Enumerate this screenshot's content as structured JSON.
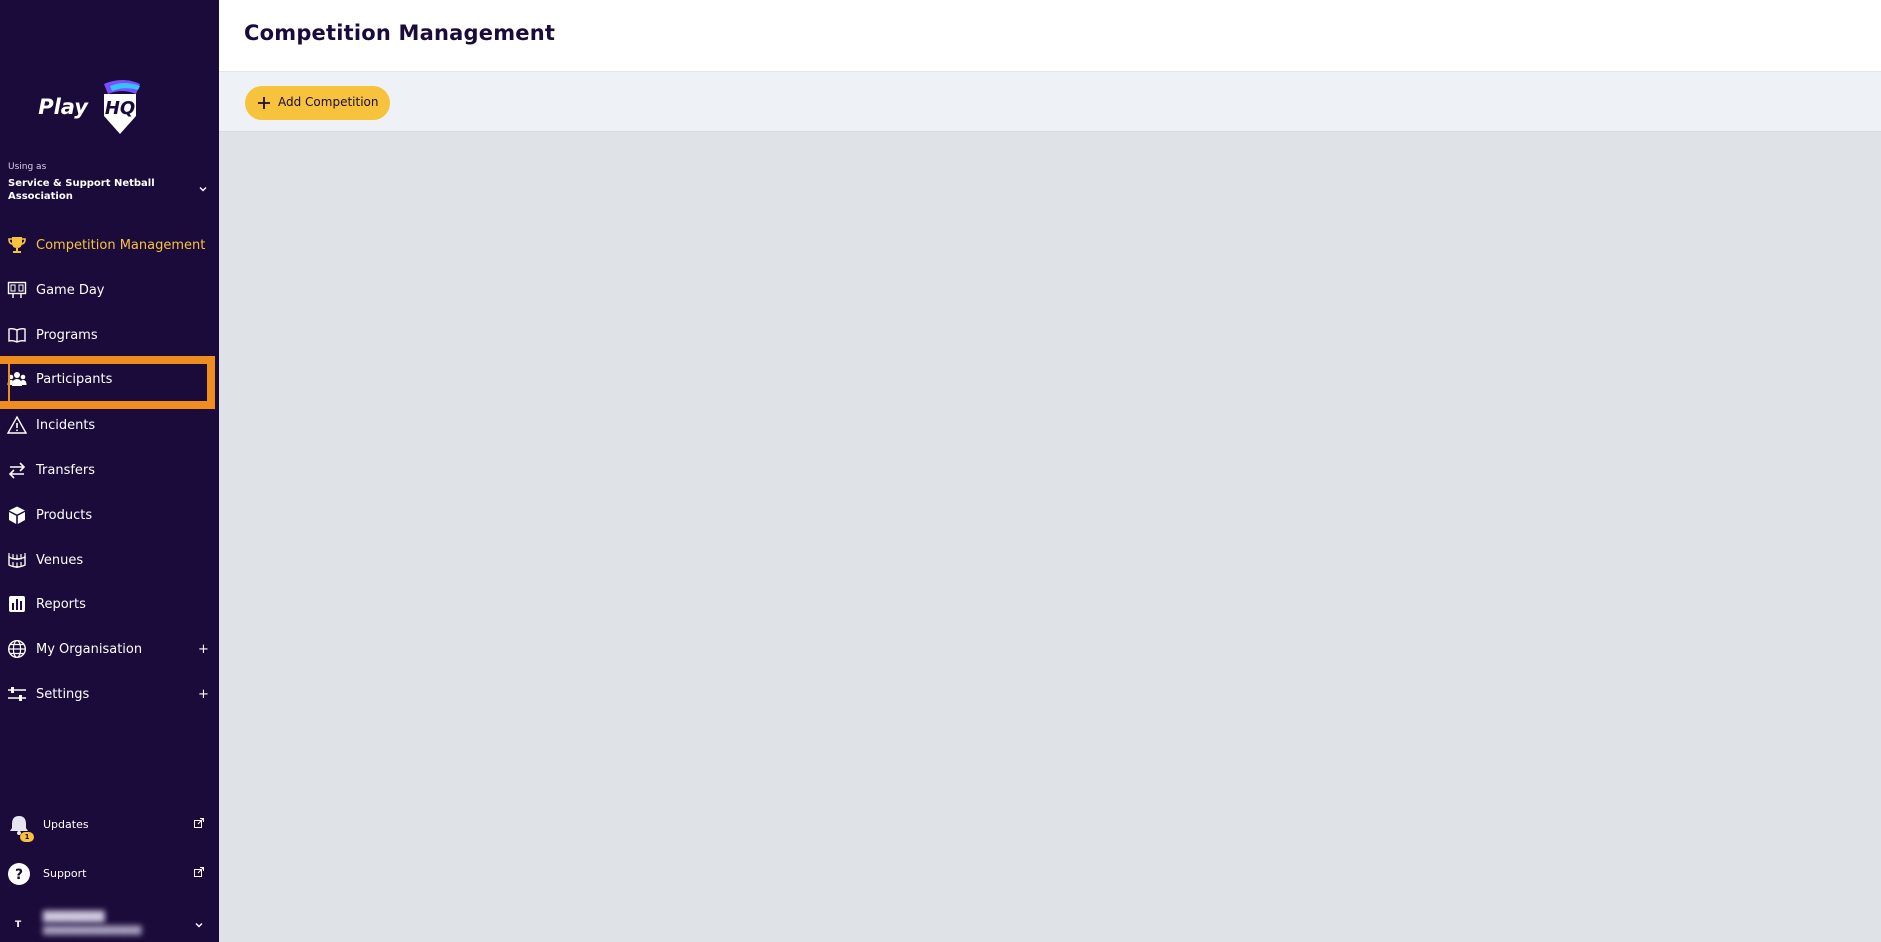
{
  "app": {
    "logo_text": "PlayHQ"
  },
  "sidebar": {
    "using_as_label": "Using as",
    "organisation": "Service & Support Netball Association",
    "items": [
      {
        "label": "Competition Management",
        "icon": "trophy-icon",
        "active": true
      },
      {
        "label": "Game Day",
        "icon": "scoreboard-icon"
      },
      {
        "label": "Programs",
        "icon": "book-icon"
      },
      {
        "label": "Participants",
        "icon": "people-icon"
      },
      {
        "label": "Incidents",
        "icon": "warning-icon"
      },
      {
        "label": "Transfers",
        "icon": "transfer-arrows-icon"
      },
      {
        "label": "Products",
        "icon": "box-icon"
      },
      {
        "label": "Venues",
        "icon": "stadium-icon"
      },
      {
        "label": "Reports",
        "icon": "report-icon"
      },
      {
        "label": "My Organisation",
        "icon": "globe-icon",
        "expand": "+"
      },
      {
        "label": "Settings",
        "icon": "sliders-icon",
        "expand": "+"
      }
    ],
    "bottom": {
      "updates_label": "Updates",
      "updates_badge": "1",
      "support_label": "Support",
      "user_initial": "T"
    }
  },
  "header": {
    "title": "Competition Management"
  },
  "toolbar": {
    "add_label": "Add Competition"
  },
  "colors": {
    "sidebar_bg": "#1b0b3b",
    "accent": "#f7c23c",
    "highlight": "#f08d1f"
  }
}
